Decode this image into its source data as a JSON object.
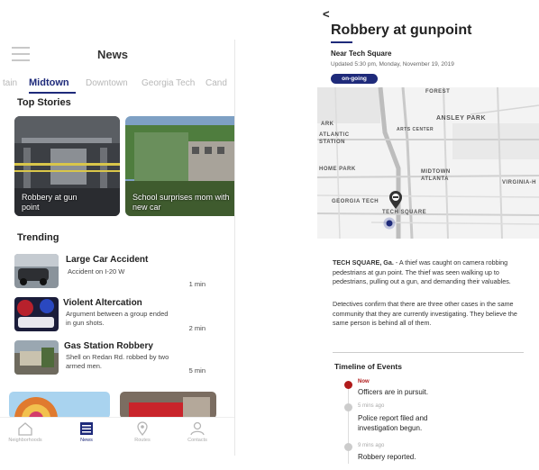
{
  "left_screen": {
    "header": {
      "title": "News",
      "menu_icon": "hamburger-icon"
    },
    "tabs": [
      {
        "label": "tain",
        "active": false
      },
      {
        "label": "Midtown",
        "active": true
      },
      {
        "label": "Downtown",
        "active": false
      },
      {
        "label": "Georgia Tech",
        "active": false
      },
      {
        "label": "Cand",
        "active": false
      }
    ],
    "top_stories": {
      "heading": "Top Stories",
      "items": [
        {
          "label": "Robbery at gun point"
        },
        {
          "label": "School surprises mom with new car"
        }
      ]
    },
    "trending": {
      "heading": "Trending",
      "items": [
        {
          "title": "Large Car Accident",
          "description": "Accident on I-20 W",
          "time": "1 min"
        },
        {
          "title": "Violent Altercation",
          "description": "Argument between a group ended in gun shots.",
          "time": "2 min"
        },
        {
          "title": "Gas Station Robbery",
          "description": "Shell on Redan Rd. robbed by two armed men.",
          "time": "5 min"
        }
      ]
    },
    "bottom_nav": [
      {
        "label": "Neighborhoods",
        "icon": "home-icon",
        "active": false
      },
      {
        "label": "News",
        "icon": "news-icon",
        "active": true
      },
      {
        "label": "Routes",
        "icon": "map-pin-icon",
        "active": false
      },
      {
        "label": "Contacts",
        "icon": "person-icon",
        "active": false
      }
    ]
  },
  "right_screen": {
    "back_icon": "back-arrow-icon",
    "back_glyph": "<",
    "title": "Robbery at gunpoint",
    "location": "Near Tech Square",
    "updated": "Updated 5:30 pm,  Monday, November 19, 2019",
    "status": "on-going",
    "map": {
      "labels": {
        "forest": "FOREST",
        "ansley_park": "ANSLEY PARK",
        "park": "ARK",
        "arts_center": "ARTS CENTER",
        "atlantic_station": "ATLANTIC STATION",
        "home_park": "HOME PARK",
        "midtown": "MIDTOWN ATLANTA",
        "virginia": "VIRGINIA-H",
        "georgia_tech": "GEORGIA TECH",
        "tech_square": "TECH SQUARE"
      }
    },
    "body": [
      {
        "dateline": "TECH SQUARE, Ga.",
        "text": " - A thief was caught on camera robbing pedestrians at gun point. The thief was seen walking up to pedestrians, pulling out a gun, and demanding their valuables."
      },
      {
        "dateline": "",
        "text": "Detectives confirm that there are three other cases in the same community that they are currently investigating. They believe the same person is behind all of them."
      }
    ],
    "timeline": {
      "heading": "Timeline of Events",
      "events": [
        {
          "time": "Now",
          "text": "Officers are in pursuit.",
          "current": true
        },
        {
          "time": "5 mins ago",
          "text": "Police report filed and investigation begun.",
          "current": false
        },
        {
          "time": "9 mins ago",
          "text": "Robbery reported.",
          "current": false
        }
      ]
    }
  }
}
